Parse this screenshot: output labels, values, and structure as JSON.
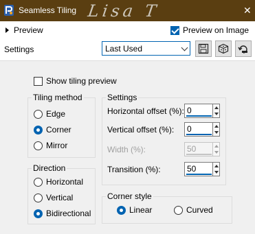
{
  "window": {
    "title": "Seamless Tiling",
    "watermark": "Lisa T",
    "title_bar_color": "#5a3e11",
    "close_icon": "close-icon"
  },
  "toolbar": {
    "preview_label": "Preview",
    "preview_on_image_label": "Preview on Image",
    "preview_on_image_checked": true,
    "settings_label": "Settings",
    "preset_value": "Last Used",
    "buttons": [
      "save-preset-icon",
      "randomize-icon",
      "reset-icon"
    ]
  },
  "options": {
    "show_tiling_preview_label": "Show tiling preview",
    "show_tiling_preview_checked": false
  },
  "tiling_method": {
    "title": "Tiling method",
    "options": [
      "Edge",
      "Corner",
      "Mirror"
    ],
    "selected": "Corner"
  },
  "direction": {
    "title": "Direction",
    "options": [
      "Horizontal",
      "Vertical",
      "Bidirectional"
    ],
    "selected": "Bidirectional"
  },
  "settings": {
    "title": "Settings",
    "horizontal_offset_label": "Horizontal offset (%):",
    "horizontal_offset_value": "0",
    "vertical_offset_label": "Vertical offset (%):",
    "vertical_offset_value": "0",
    "width_label": "Width (%):",
    "width_value": "50",
    "width_disabled": true,
    "transition_label": "Transition (%):",
    "transition_value": "50"
  },
  "corner_style": {
    "title": "Corner style",
    "options": [
      "Linear",
      "Curved"
    ],
    "selected": "Linear"
  },
  "colors": {
    "accent": "#0063b1",
    "panel_bg": "#f0f0f0"
  }
}
